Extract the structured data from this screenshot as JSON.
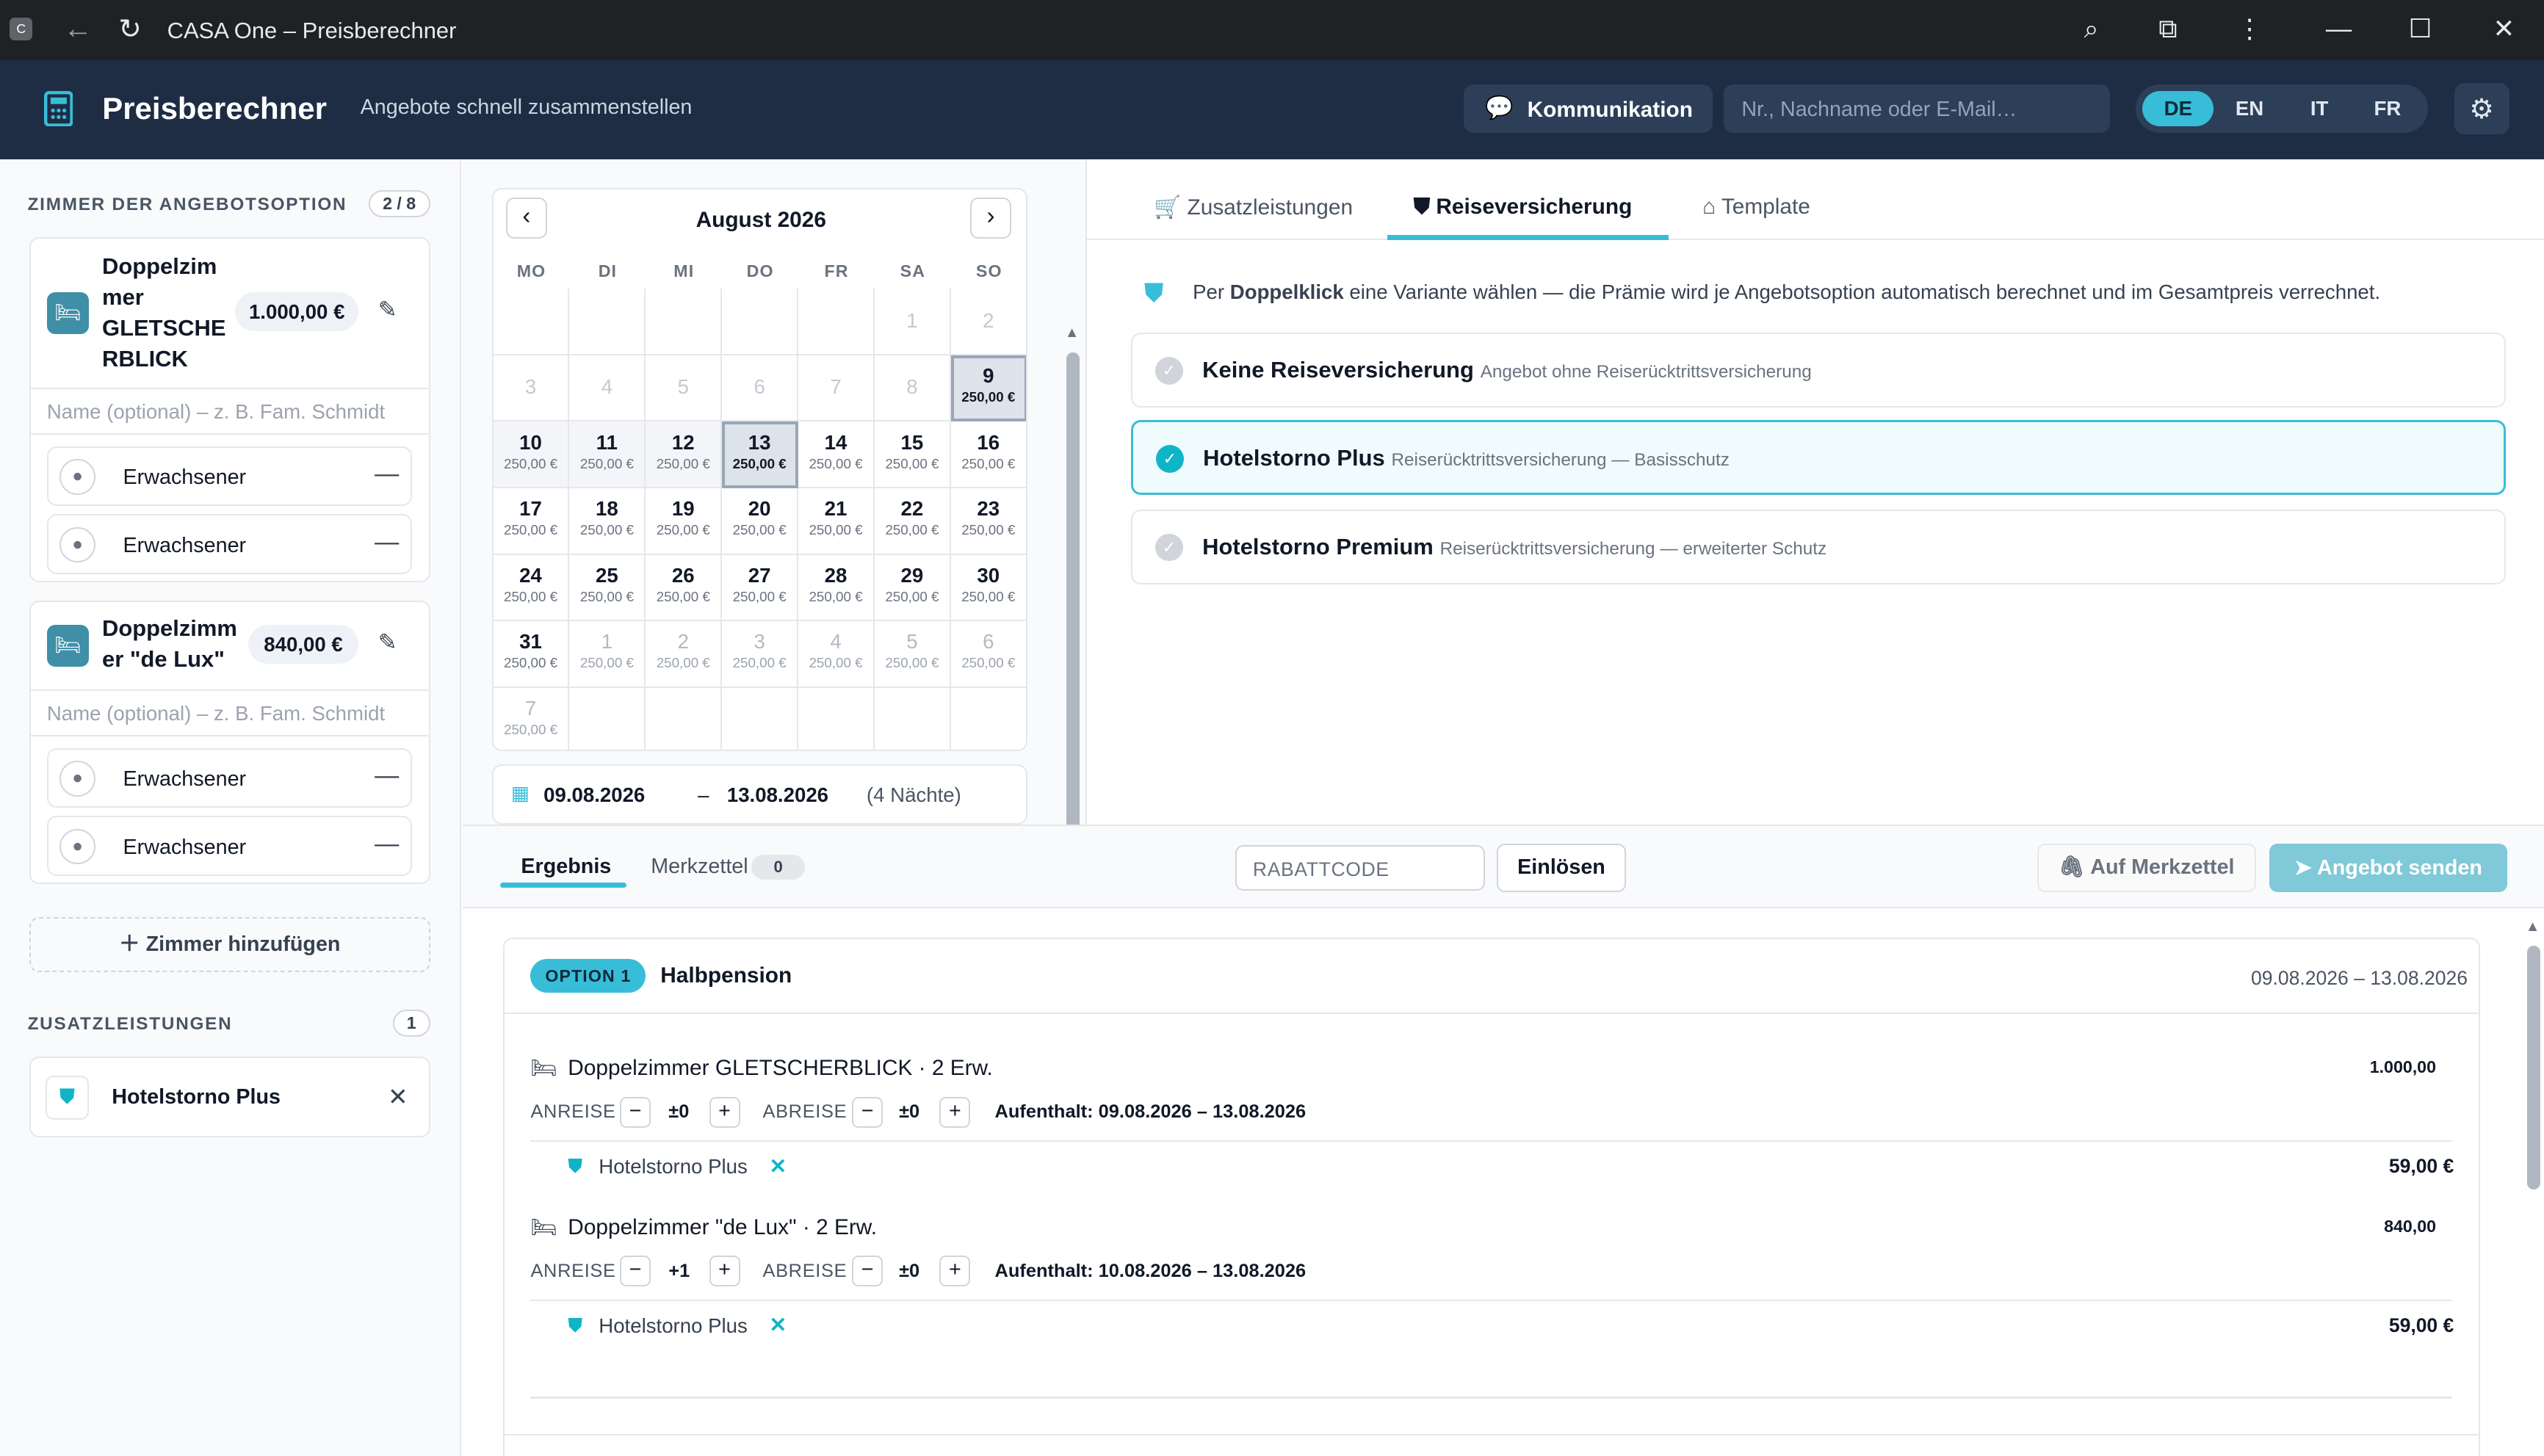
{
  "browser": {
    "title": "CASA One – Preisberechner"
  },
  "app": {
    "title": "Preisberechner",
    "subtitle": "Angebote schnell zusammenstellen",
    "comm_label": "Kommunikation",
    "search_placeholder": "Nr., Nachname oder E-Mail…",
    "langs": [
      "DE",
      "EN",
      "IT",
      "FR"
    ],
    "active_lang": "DE",
    "accent": "#38bdd8",
    "header_bg": "#1e2d44"
  },
  "left": {
    "rooms_heading": "ZIMMER DER ANGEBOTSOPTION",
    "rooms_count": "2 / 8",
    "rooms": [
      {
        "name_lines": [
          "Doppelzim",
          "mer",
          "GLETSCHE",
          "RBLICK"
        ],
        "price": "1.000,00 €",
        "name_placeholder": "Name (optional) – z. B. Fam. Schmidt",
        "guests": [
          "Erwachsener",
          "Erwachsener"
        ]
      },
      {
        "name_lines": [
          "Doppelzimm",
          "er \"de Lux\""
        ],
        "price": "840,00 €",
        "name_placeholder": "Name (optional) – z. B. Fam. Schmidt",
        "guests": [
          "Erwachsener",
          "Erwachsener"
        ]
      }
    ],
    "add_room": "Zimmer hinzufügen",
    "extras_heading": "ZUSATZLEISTUNGEN",
    "extras_count": "1",
    "extras": [
      {
        "label": "Hotelstorno Plus"
      }
    ]
  },
  "calendar": {
    "month": "August 2026",
    "weekdays": [
      "MO",
      "DI",
      "MI",
      "DO",
      "FR",
      "SA",
      "SO"
    ],
    "weeks": [
      [
        {
          "d": "",
          "s": "e"
        },
        {
          "d": "",
          "s": "e"
        },
        {
          "d": "",
          "s": "e"
        },
        {
          "d": "",
          "s": "e"
        },
        {
          "d": "",
          "s": "e"
        },
        {
          "d": "1",
          "s": "e"
        },
        {
          "d": "2",
          "s": "e"
        }
      ],
      [
        {
          "d": "3",
          "s": "e"
        },
        {
          "d": "4",
          "s": "e"
        },
        {
          "d": "5",
          "s": "e"
        },
        {
          "d": "6",
          "s": "e"
        },
        {
          "d": "7",
          "s": "e"
        },
        {
          "d": "8",
          "s": "e"
        },
        {
          "d": "9",
          "p": "250,00 €",
          "s": "sel"
        }
      ],
      [
        {
          "d": "10",
          "p": "250,00 €",
          "s": "wk"
        },
        {
          "d": "11",
          "p": "250,00 €",
          "s": "wk"
        },
        {
          "d": "12",
          "p": "250,00 €",
          "s": "wk"
        },
        {
          "d": "13",
          "p": "250,00 €",
          "s": "sel"
        },
        {
          "d": "14",
          "p": "250,00 €"
        },
        {
          "d": "15",
          "p": "250,00 €"
        },
        {
          "d": "16",
          "p": "250,00 €"
        }
      ],
      [
        {
          "d": "17",
          "p": "250,00 €"
        },
        {
          "d": "18",
          "p": "250,00 €"
        },
        {
          "d": "19",
          "p": "250,00 €"
        },
        {
          "d": "20",
          "p": "250,00 €"
        },
        {
          "d": "21",
          "p": "250,00 €"
        },
        {
          "d": "22",
          "p": "250,00 €"
        },
        {
          "d": "23",
          "p": "250,00 €"
        }
      ],
      [
        {
          "d": "24",
          "p": "250,00 €"
        },
        {
          "d": "25",
          "p": "250,00 €"
        },
        {
          "d": "26",
          "p": "250,00 €"
        },
        {
          "d": "27",
          "p": "250,00 €"
        },
        {
          "d": "28",
          "p": "250,00 €"
        },
        {
          "d": "29",
          "p": "250,00 €"
        },
        {
          "d": "30",
          "p": "250,00 €"
        }
      ],
      [
        {
          "d": "31",
          "p": "250,00 €"
        },
        {
          "d": "1",
          "p": "250,00 €",
          "s": "dim"
        },
        {
          "d": "2",
          "p": "250,00 €",
          "s": "dim"
        },
        {
          "d": "3",
          "p": "250,00 €",
          "s": "dim"
        },
        {
          "d": "4",
          "p": "250,00 €",
          "s": "dim"
        },
        {
          "d": "5",
          "p": "250,00 €",
          "s": "dim"
        },
        {
          "d": "6",
          "p": "250,00 €",
          "s": "dim"
        }
      ],
      [
        {
          "d": "7",
          "p": "250,00 €",
          "s": "dim"
        },
        {
          "d": "",
          "s": "blank"
        },
        {
          "d": "",
          "s": "blank"
        },
        {
          "d": "",
          "s": "blank"
        },
        {
          "d": "",
          "s": "blank"
        },
        {
          "d": "",
          "s": "blank"
        },
        {
          "d": "",
          "s": "blank"
        }
      ]
    ],
    "range_from": "09.08.2026",
    "range_sep": "–",
    "range_to": "13.08.2026",
    "range_nights": "(4 Nächte)"
  },
  "tabs": {
    "items": [
      "Zusatzleistungen",
      "Reiseversicherung",
      "Template"
    ],
    "active": "Reiseversicherung"
  },
  "insurance": {
    "hint_pre": "Per",
    "hint_bold": "Doppelklick",
    "hint_post": "eine Variante wählen — die Prämie wird je Angebotsoption automatisch berechnet und im Gesamtpreis verrechnet.",
    "options": [
      {
        "title": "Keine Reiseversicherung",
        "desc": "Angebot ohne Reiserücktrittsversicherung",
        "selected": false
      },
      {
        "title": "Hotelstorno Plus",
        "desc": "Reiserücktrittsversicherung — Basisschutz",
        "selected": true
      },
      {
        "title": "Hotelstorno Premium",
        "desc": "Reiserücktrittsversicherung — erweiterter Schutz",
        "selected": false
      }
    ]
  },
  "result": {
    "tab_result": "Ergebnis",
    "tab_notes": "Merkzettel",
    "notes_count": "0",
    "discount_placeholder": "RABATTCODE",
    "redeem": "Einlösen",
    "to_notes": "Auf Merkzettel",
    "send": "Angebot senden",
    "option_badge": "OPTION 1",
    "option_title": "Halbpension",
    "option_dates": "09.08.2026 – 13.08.2026",
    "arrival_label": "ANREISE",
    "departure_label": "ABREISE",
    "lines": [
      {
        "room": "Doppelzimmer GLETSCHERBLICK · 2 Erw.",
        "amount": "1.000,00",
        "arr": "±0",
        "dep": "±0",
        "stay": "Aufenthalt: 09.08.2026 – 13.08.2026",
        "extra": "Hotelstorno Plus",
        "extra_amount": "59,00 €"
      },
      {
        "room": "Doppelzimmer \"de Lux\" · 2 Erw.",
        "amount": "840,00",
        "arr": "+1",
        "dep": "±0",
        "stay": "Aufenthalt: 10.08.2026 – 13.08.2026",
        "extra": "Hotelstorno Plus",
        "extra_amount": "59,00 €"
      }
    ]
  }
}
